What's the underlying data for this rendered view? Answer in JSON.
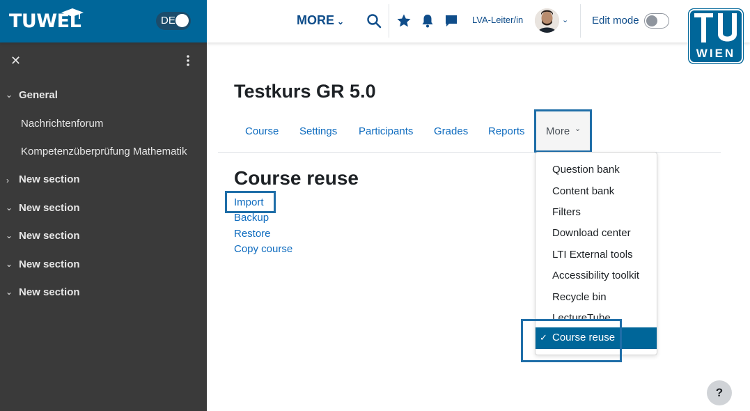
{
  "header": {
    "logo_text": "TUWEL",
    "language": "DE",
    "more_label": "MORE",
    "role_label": "LVA-Leiter/in",
    "edit_mode_label": "Edit mode",
    "edit_mode_on": false,
    "tu_logo": {
      "line1": "TU",
      "line2": "WIEN"
    }
  },
  "sidebar": {
    "items": [
      {
        "label": "General",
        "type": "section",
        "expanded": true
      },
      {
        "label": "Nachrichtenforum",
        "type": "activity"
      },
      {
        "label": "Kompetenzüberprüfung Mathematik",
        "type": "activity"
      },
      {
        "label": "New section",
        "type": "section",
        "expanded": false
      },
      {
        "label": "New section",
        "type": "section",
        "expanded": true
      },
      {
        "label": "New section",
        "type": "section",
        "expanded": true
      },
      {
        "label": "New section",
        "type": "section",
        "expanded": true
      },
      {
        "label": "New section",
        "type": "section",
        "expanded": true
      }
    ]
  },
  "course": {
    "title": "Testkurs GR 5.0",
    "tabs": [
      "Course",
      "Settings",
      "Participants",
      "Grades",
      "Reports",
      "More"
    ]
  },
  "main": {
    "heading": "Course reuse",
    "links": [
      "Import",
      "Backup",
      "Restore",
      "Copy course"
    ]
  },
  "more_dropdown": {
    "items": [
      "Question bank",
      "Content bank",
      "Filters",
      "Download center",
      "LTI External tools",
      "Accessibility toolkit",
      "Recycle bin",
      "LectureTube"
    ],
    "active_item": "Course reuse"
  },
  "help": {
    "label": "?"
  },
  "colors": {
    "brand": "#006699",
    "sidebar": "#3a3a3a",
    "link": "#0f6cbf",
    "highlight": "#1f6ea8"
  }
}
